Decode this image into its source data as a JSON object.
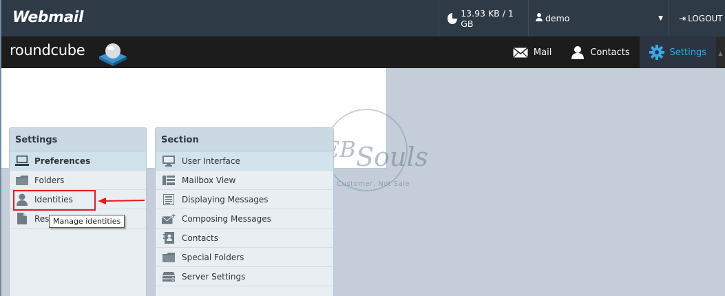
{
  "topbar": {
    "brand": "Webmail",
    "quota": "13.93 KB / 1 GB",
    "username": "demo",
    "logout": "LOGOUT"
  },
  "navbar": {
    "logo_text": "roundcube",
    "items": [
      {
        "label": "Mail",
        "icon": "envelope-icon",
        "active": false
      },
      {
        "label": "Contacts",
        "icon": "contacts-icon",
        "active": false
      },
      {
        "label": "Settings",
        "icon": "gear-icon",
        "active": true
      }
    ]
  },
  "settings_panel": {
    "title": "Settings",
    "items": [
      {
        "label": "Preferences",
        "icon": "laptop-icon"
      },
      {
        "label": "Folders",
        "icon": "folder-icon"
      },
      {
        "label": "Identities",
        "icon": "identity-icon"
      },
      {
        "label": "Res",
        "icon": "document-icon"
      }
    ]
  },
  "tooltip": "Manage identities",
  "section_panel": {
    "title": "Section",
    "items": [
      {
        "label": "User Interface",
        "icon": "monitor-icon"
      },
      {
        "label": "Mailbox View",
        "icon": "mailbox-view-icon"
      },
      {
        "label": "Displaying Messages",
        "icon": "message-display-icon"
      },
      {
        "label": "Composing Messages",
        "icon": "compose-icon"
      },
      {
        "label": "Contacts",
        "icon": "contact-card-icon"
      },
      {
        "label": "Special Folders",
        "icon": "folder-icon"
      },
      {
        "label": "Server Settings",
        "icon": "server-icon"
      }
    ]
  },
  "watermark": {
    "web": "WEB",
    "souls": "Souls",
    "tagline": "We Make Customer, Not Sale"
  },
  "colors": {
    "accent": "#3aa7e6",
    "highlight": "#e41b23",
    "topbar": "#2f3a47",
    "navbar": "#1c1c1c"
  }
}
